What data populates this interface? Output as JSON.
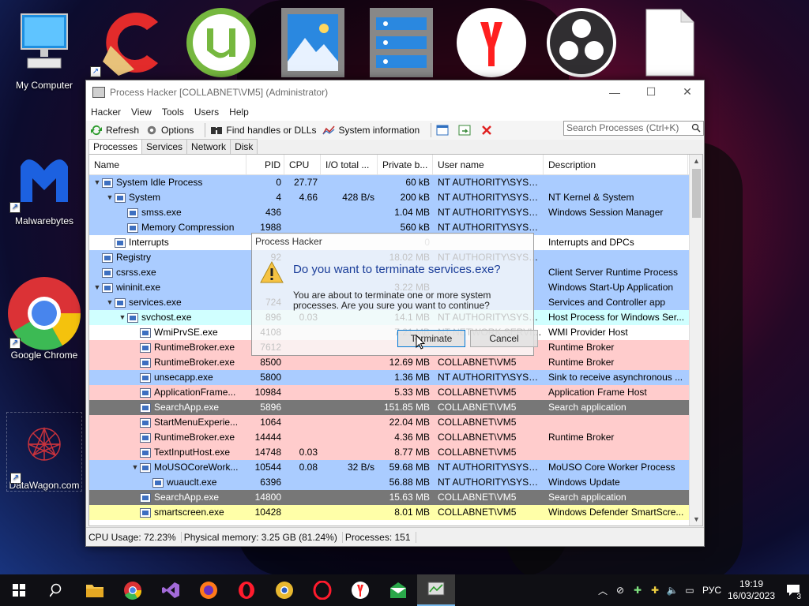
{
  "desktop": {
    "icons": [
      {
        "label": "My Computer"
      },
      {
        "label": "Malwarebytes"
      },
      {
        "label": "Google Chrome"
      },
      {
        "label": "DataWagon.com"
      }
    ]
  },
  "window": {
    "title": "Process Hacker [COLLABNET\\VM5] (Administrator)",
    "menu": [
      "Hacker",
      "View",
      "Tools",
      "Users",
      "Help"
    ],
    "toolbar": {
      "refresh": "Refresh",
      "options": "Options",
      "find_handles": "Find handles or DLLs",
      "system_info": "System information"
    },
    "search_placeholder": "Search Processes (Ctrl+K)",
    "tabs": [
      "Processes",
      "Services",
      "Network",
      "Disk"
    ],
    "columns": [
      "Name",
      "PID",
      "CPU",
      "I/O total ...",
      "Private b...",
      "User name",
      "Description"
    ],
    "rows": [
      {
        "name": "System Idle Process",
        "pid": "0",
        "cpu": "27.77",
        "io": "",
        "priv": "60 kB",
        "user": "NT AUTHORITY\\SYSTEM",
        "desc": "",
        "indent": 0,
        "arrow": "v",
        "color": "blue"
      },
      {
        "name": "System",
        "pid": "4",
        "cpu": "4.66",
        "io": "428 B/s",
        "priv": "200 kB",
        "user": "NT AUTHORITY\\SYSTEM",
        "desc": "NT Kernel & System",
        "indent": 1,
        "arrow": "v",
        "color": "blue"
      },
      {
        "name": "smss.exe",
        "pid": "436",
        "cpu": "",
        "io": "",
        "priv": "1.04 MB",
        "user": "NT AUTHORITY\\SYSTEM",
        "desc": "Windows Session Manager",
        "indent": 2,
        "arrow": "",
        "color": "blue"
      },
      {
        "name": "Memory Compression",
        "pid": "1988",
        "cpu": "",
        "io": "",
        "priv": "560 kB",
        "user": "NT AUTHORITY\\SYSTEM",
        "desc": "",
        "indent": 2,
        "arrow": "",
        "color": "blue"
      },
      {
        "name": "Interrupts",
        "pid": "",
        "cpu": "",
        "io": "",
        "priv": "0",
        "user": "",
        "desc": "Interrupts and DPCs",
        "indent": 1,
        "arrow": "",
        "color": "white"
      },
      {
        "name": "Registry",
        "pid": "92",
        "cpu": "",
        "io": "",
        "priv": "18.02 MB",
        "user": "NT AUTHORITY\\SYSTEM",
        "desc": "",
        "indent": 0,
        "arrow": "",
        "color": "blue"
      },
      {
        "name": "csrss.exe",
        "pid": "",
        "cpu": "",
        "io": "",
        "priv": "",
        "user": "",
        "desc": "Client Server Runtime Process",
        "indent": 0,
        "arrow": "",
        "color": "blue"
      },
      {
        "name": "wininit.exe",
        "pid": "",
        "cpu": "",
        "io": "",
        "priv": "3.22 MB",
        "user": "",
        "desc": "Windows Start-Up Application",
        "indent": 0,
        "arrow": "v",
        "color": "blue"
      },
      {
        "name": "services.exe",
        "pid": "724",
        "cpu": "",
        "io": "",
        "priv": "",
        "user": "",
        "desc": "Services and Controller app",
        "indent": 1,
        "arrow": "v",
        "color": "blue"
      },
      {
        "name": "svchost.exe",
        "pid": "896",
        "cpu": "0.03",
        "io": "",
        "priv": "14.1 MB",
        "user": "NT AUTHORITY\\SYSTEM",
        "desc": "Host Process for Windows Ser...",
        "indent": 2,
        "arrow": "v",
        "color": "cyan"
      },
      {
        "name": "WmiPrvSE.exe",
        "pid": "4108",
        "cpu": "",
        "io": "",
        "priv": "7.21 MB",
        "user": "NT NETWORK SERVICE",
        "desc": "WMI Provider Host",
        "indent": 3,
        "arrow": "",
        "color": "white"
      },
      {
        "name": "RuntimeBroker.exe",
        "pid": "7612",
        "cpu": "",
        "io": "",
        "priv": "",
        "user": "",
        "desc": "Runtime Broker",
        "indent": 3,
        "arrow": "",
        "color": "pink"
      },
      {
        "name": "RuntimeBroker.exe",
        "pid": "8500",
        "cpu": "",
        "io": "",
        "priv": "12.69 MB",
        "user": "COLLABNET\\VM5",
        "desc": "Runtime Broker",
        "indent": 3,
        "arrow": "",
        "color": "pink"
      },
      {
        "name": "unsecapp.exe",
        "pid": "5800",
        "cpu": "",
        "io": "",
        "priv": "1.36 MB",
        "user": "NT AUTHORITY\\SYSTEM",
        "desc": "Sink to receive asynchronous ...",
        "indent": 3,
        "arrow": "",
        "color": "blue"
      },
      {
        "name": "ApplicationFrame...",
        "pid": "10984",
        "cpu": "",
        "io": "",
        "priv": "5.33 MB",
        "user": "COLLABNET\\VM5",
        "desc": "Application Frame Host",
        "indent": 3,
        "arrow": "",
        "color": "pink"
      },
      {
        "name": "SearchApp.exe",
        "pid": "5896",
        "cpu": "",
        "io": "",
        "priv": "151.85 MB",
        "user": "COLLABNET\\VM5",
        "desc": "Search application",
        "indent": 3,
        "arrow": "",
        "color": "gray"
      },
      {
        "name": "StartMenuExperie...",
        "pid": "1064",
        "cpu": "",
        "io": "",
        "priv": "22.04 MB",
        "user": "COLLABNET\\VM5",
        "desc": "",
        "indent": 3,
        "arrow": "",
        "color": "pink"
      },
      {
        "name": "RuntimeBroker.exe",
        "pid": "14444",
        "cpu": "",
        "io": "",
        "priv": "4.36 MB",
        "user": "COLLABNET\\VM5",
        "desc": "Runtime Broker",
        "indent": 3,
        "arrow": "",
        "color": "pink"
      },
      {
        "name": "TextInputHost.exe",
        "pid": "14748",
        "cpu": "0.03",
        "io": "",
        "priv": "8.77 MB",
        "user": "COLLABNET\\VM5",
        "desc": "",
        "indent": 3,
        "arrow": "",
        "color": "pink"
      },
      {
        "name": "MoUSOCoreWork...",
        "pid": "10544",
        "cpu": "0.08",
        "io": "32 B/s",
        "priv": "59.68 MB",
        "user": "NT AUTHORITY\\SYSTEM",
        "desc": "MoUSO Core Worker Process",
        "indent": 3,
        "arrow": "v",
        "color": "blue"
      },
      {
        "name": "wuauclt.exe",
        "pid": "6396",
        "cpu": "",
        "io": "",
        "priv": "56.88 MB",
        "user": "NT AUTHORITY\\SYSTEM",
        "desc": "Windows Update",
        "indent": 4,
        "arrow": "",
        "color": "blue"
      },
      {
        "name": "SearchApp.exe",
        "pid": "14800",
        "cpu": "",
        "io": "",
        "priv": "15.63 MB",
        "user": "COLLABNET\\VM5",
        "desc": "Search application",
        "indent": 3,
        "arrow": "",
        "color": "gray"
      },
      {
        "name": "smartscreen.exe",
        "pid": "10428",
        "cpu": "",
        "io": "",
        "priv": "8.01 MB",
        "user": "COLLABNET\\VM5",
        "desc": "Windows Defender SmartScre...",
        "indent": 3,
        "arrow": "",
        "color": "yellow"
      }
    ],
    "status": {
      "cpu": "CPU Usage: 72.23%",
      "memory": "Physical memory: 3.25 GB (81.24%)",
      "processes": "Processes: 151"
    }
  },
  "dialog": {
    "title": "Process Hacker",
    "heading": "Do you want to terminate services.exe?",
    "body": "You are about to terminate one or more system processes. Are you sure you want to continue?",
    "terminate": "Terminate",
    "cancel": "Cancel"
  },
  "taskbar": {
    "language": "РУС",
    "time": "19:19",
    "date": "16/03/2023",
    "notifications": "3"
  },
  "colors": {
    "blue": "#aaccff",
    "pink": "#ffcccc",
    "gray": "#777777",
    "yellow": "#ffffa8",
    "cyan": "#d0ffff",
    "white": "#ffffff"
  }
}
